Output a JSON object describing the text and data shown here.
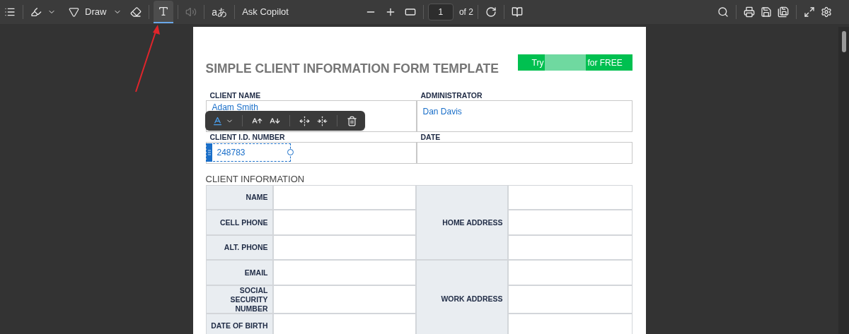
{
  "toolbar": {
    "draw_label": "Draw",
    "translate_glyph": "aあ",
    "copilot_label": "Ask Copilot",
    "page_number": "1",
    "page_count": "of 2",
    "add_text_selected": true,
    "read_aloud_disabled": true
  },
  "document": {
    "title": "SIMPLE CLIENT INFORMATION FORM TEMPLATE",
    "promo": {
      "before": "Try",
      "after": "for FREE"
    },
    "header_fields": [
      {
        "label": "CLIENT NAME",
        "value": "Adam Smith",
        "editing": false
      },
      {
        "label": "ADMINISTRATOR",
        "value": "Dan Davis",
        "editing": false
      },
      {
        "label": "CLIENT I.D. NUMBER",
        "value": "248783",
        "editing": true
      },
      {
        "label": "DATE",
        "editing": false
      }
    ],
    "section_title": "CLIENT INFORMATION",
    "rows": [
      "NAME",
      "CELL PHONE",
      "ALT. PHONE",
      "EMAIL",
      "SOCIAL SECURITY NUMBER",
      "DATE OF BIRTH"
    ],
    "address_groups": [
      {
        "label": "HOME ADDRESS"
      },
      {
        "label": "WORK ADDRESS"
      }
    ]
  }
}
